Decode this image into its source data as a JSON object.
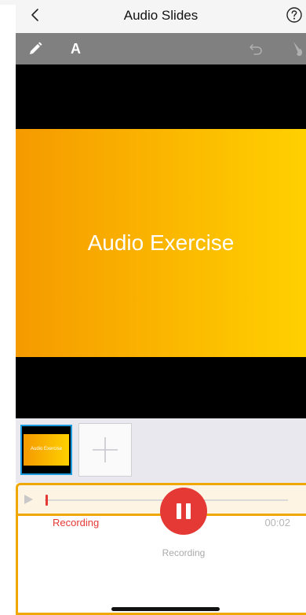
{
  "nav": {
    "title": "Audio Slides"
  },
  "toolbar": {
    "text_tool": "A"
  },
  "slide": {
    "title": "Audio Exercise"
  },
  "thumbnails": [
    {
      "label": "Audio Exercise",
      "selected": true
    }
  ],
  "recorder": {
    "status": "Recording",
    "time": "00:02",
    "progress": 0.0,
    "button_label": "Recording"
  },
  "colors": {
    "accent": "#f0a800",
    "record": "#e53935",
    "toolbar": "#808080"
  },
  "icons": [
    "back-icon",
    "help-icon",
    "pen-icon",
    "undo-icon",
    "brush-icon",
    "add-icon",
    "play-icon",
    "pause-icon"
  ]
}
